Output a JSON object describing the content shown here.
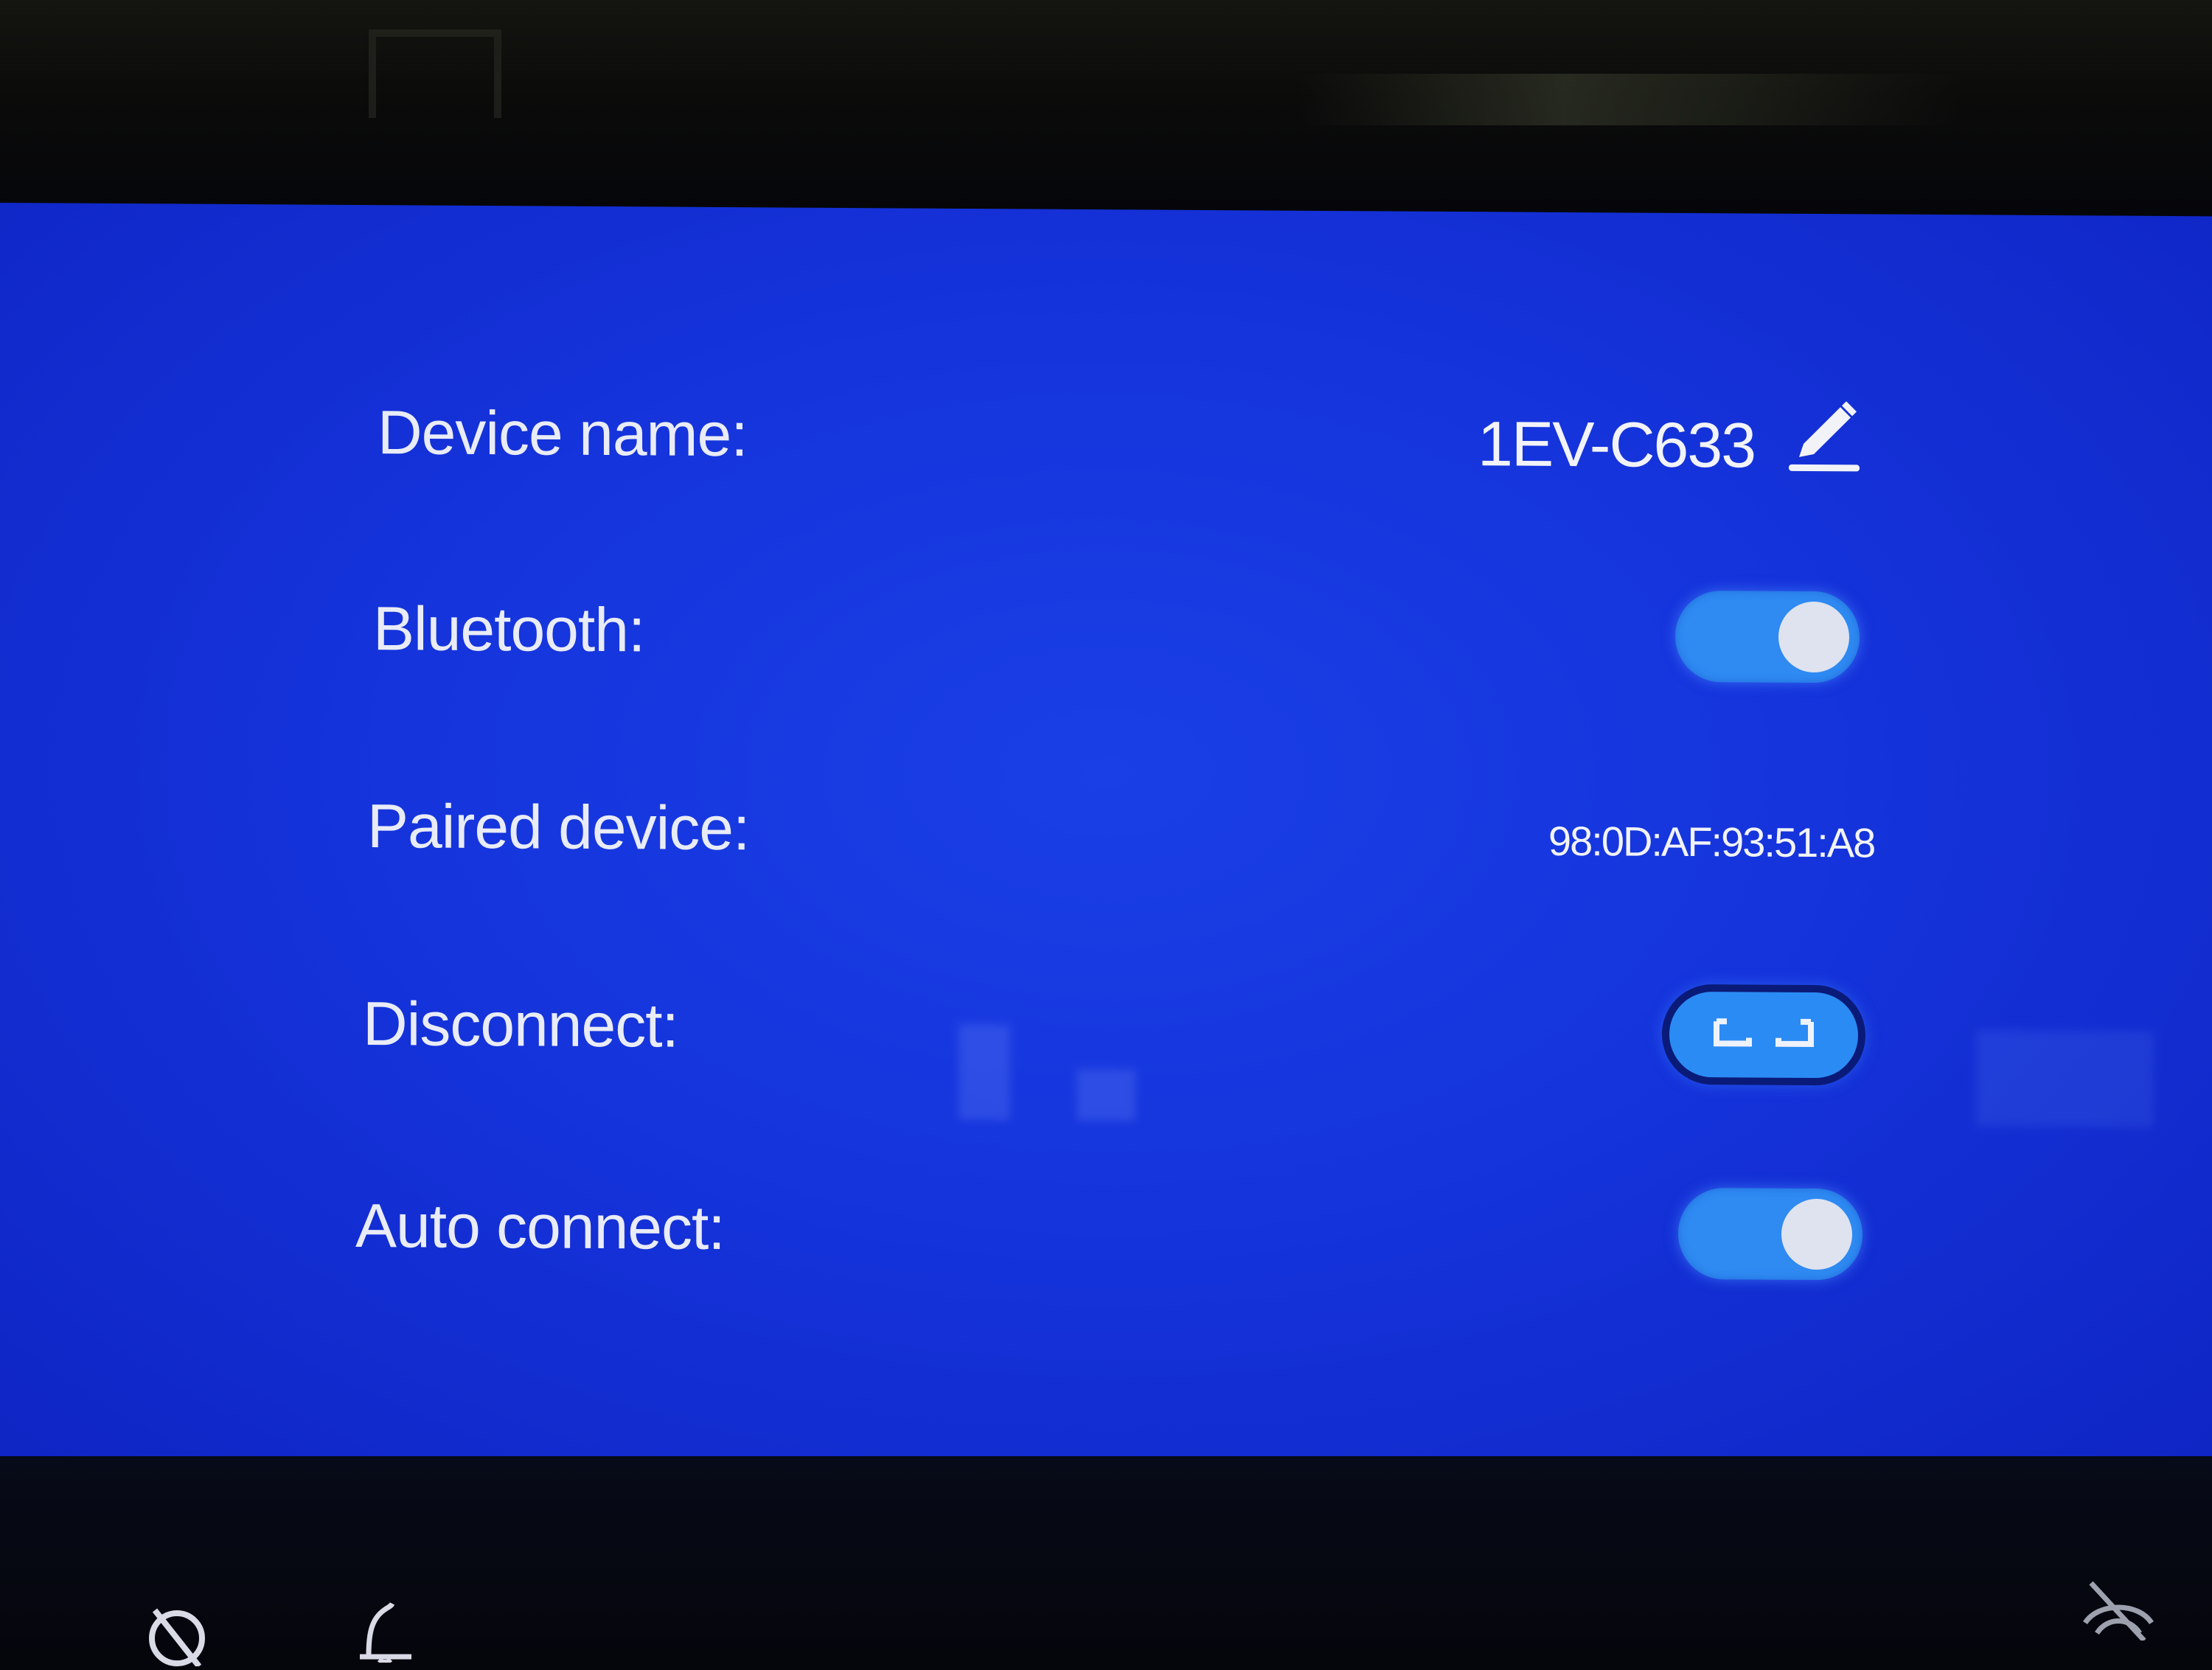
{
  "settings": {
    "device_name": {
      "label": "Device name:",
      "value": "1EV-C633",
      "edit_icon": "pencil-icon"
    },
    "bluetooth": {
      "label": "Bluetooth:",
      "state": "on"
    },
    "paired_device": {
      "label": "Paired device:",
      "value": "98:0D:AF:93:51:A8"
    },
    "disconnect": {
      "label": "Disconnect:",
      "button_icon": "disconnect-link-icon"
    },
    "auto_connect": {
      "label": "Auto connect:",
      "state": "on"
    }
  },
  "bottom_bar": {
    "left_icons": [
      "no-signal-icon",
      "bell-icon"
    ],
    "right_icons": [
      "no-wireless-icon"
    ]
  },
  "colors": {
    "screen_background": "#1534dc",
    "toggle_on": "#2f8af2",
    "knob": "#dfe3ef",
    "text": "#e9ecf6"
  }
}
